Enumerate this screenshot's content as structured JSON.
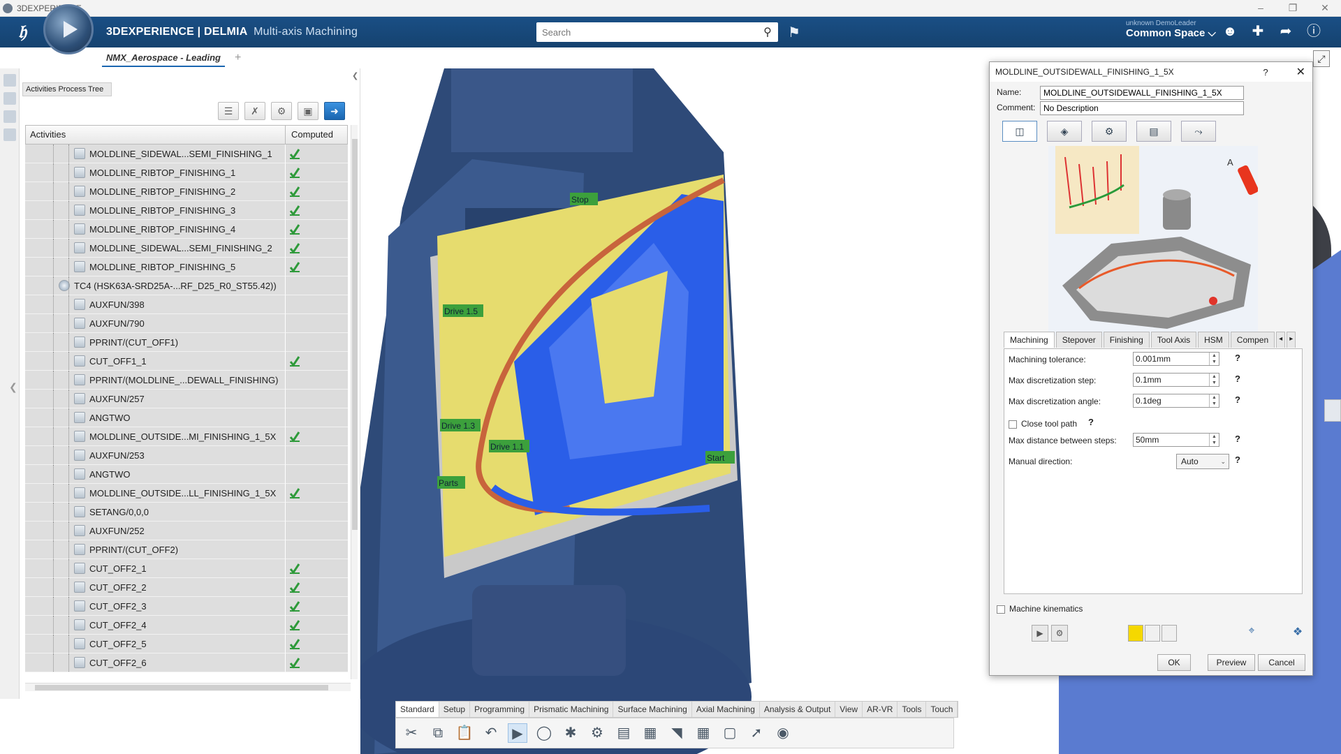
{
  "window": {
    "title": "3DEXPERIENCE"
  },
  "header": {
    "brand_bold": "3DEXPERIENCE | DELMIA",
    "brand_app": "Multi-axis Machining",
    "search_placeholder": "Search",
    "user": "unknown DemoLeader",
    "space": "Common Space ⌵"
  },
  "doc_tab": {
    "label": "NMX_Aerospace - Leading",
    "add": "+"
  },
  "tree": {
    "tab_label": "Activities Process Tree",
    "col_activities": "Activities",
    "col_computed": "Computed",
    "rows": [
      {
        "label": "MOLDLINE_SIDEWAL...SEMI_FINISHING_1",
        "computed": true,
        "indent": 1
      },
      {
        "label": "MOLDLINE_RIBTOP_FINISHING_1",
        "computed": true,
        "indent": 1
      },
      {
        "label": "MOLDLINE_RIBTOP_FINISHING_2",
        "computed": true,
        "indent": 1
      },
      {
        "label": "MOLDLINE_RIBTOP_FINISHING_3",
        "computed": true,
        "indent": 1
      },
      {
        "label": "MOLDLINE_RIBTOP_FINISHING_4",
        "computed": true,
        "indent": 1
      },
      {
        "label": "MOLDLINE_SIDEWAL...SEMI_FINISHING_2",
        "computed": true,
        "indent": 1
      },
      {
        "label": "MOLDLINE_RIBTOP_FINISHING_5",
        "computed": true,
        "indent": 1
      },
      {
        "label": "TC4 (HSK63A-SRD25A-...RF_D25_R0_ST55.42))",
        "computed": false,
        "indent": 0,
        "tool": true
      },
      {
        "label": "AUXFUN/398",
        "computed": false,
        "indent": 1
      },
      {
        "label": "AUXFUN/790",
        "computed": false,
        "indent": 1
      },
      {
        "label": "PPRINT/(CUT_OFF1)",
        "computed": false,
        "indent": 1
      },
      {
        "label": "CUT_OFF1_1",
        "computed": true,
        "indent": 1
      },
      {
        "label": "PPRINT/(MOLDLINE_...DEWALL_FINISHING)",
        "computed": false,
        "indent": 1
      },
      {
        "label": "AUXFUN/257",
        "computed": false,
        "indent": 1
      },
      {
        "label": "ANGTWO",
        "computed": false,
        "indent": 1
      },
      {
        "label": "MOLDLINE_OUTSIDE...MI_FINISHING_1_5X",
        "computed": true,
        "indent": 1
      },
      {
        "label": "AUXFUN/253",
        "computed": false,
        "indent": 1
      },
      {
        "label": "ANGTWO",
        "computed": false,
        "indent": 1
      },
      {
        "label": "MOLDLINE_OUTSIDE...LL_FINISHING_1_5X",
        "computed": true,
        "indent": 1
      },
      {
        "label": "SETANG/0,0,0",
        "computed": false,
        "indent": 1
      },
      {
        "label": "AUXFUN/252",
        "computed": false,
        "indent": 1
      },
      {
        "label": "PPRINT/(CUT_OFF2)",
        "computed": false,
        "indent": 1
      },
      {
        "label": "CUT_OFF2_1",
        "computed": true,
        "indent": 1
      },
      {
        "label": "CUT_OFF2_2",
        "computed": true,
        "indent": 1
      },
      {
        "label": "CUT_OFF2_3",
        "computed": true,
        "indent": 1
      },
      {
        "label": "CUT_OFF2_4",
        "computed": true,
        "indent": 1
      },
      {
        "label": "CUT_OFF2_5",
        "computed": true,
        "indent": 1
      },
      {
        "label": "CUT_OFF2_6",
        "computed": true,
        "indent": 1
      }
    ]
  },
  "viewport_labels": {
    "stop": "Stop",
    "drive15": "Drive 1.5",
    "drive13": "Drive 1.3",
    "drive11": "Drive 1.1",
    "start": "Start",
    "parts": "Parts"
  },
  "bottom_tabs": [
    "Standard",
    "Setup",
    "Programming",
    "Prismatic Machining",
    "Surface Machining",
    "Axial Machining",
    "Analysis & Output",
    "View",
    "AR-VR",
    "Tools",
    "Touch"
  ],
  "dialog": {
    "title": "MOLDLINE_OUTSIDEWALL_FINISHING_1_5X",
    "help": "?",
    "close": "✕",
    "name_label": "Name:",
    "name_value": "MOLDLINE_OUTSIDEWALL_FINISHING_1_5X",
    "comment_label": "Comment:",
    "comment_value": "No Description",
    "illus_letter": "A",
    "tabs": [
      "Machining",
      "Stepover",
      "Finishing",
      "Tool Axis",
      "HSM",
      "Compen"
    ],
    "params": {
      "tol_label": "Machining tolerance:",
      "tol_value": "0.001mm",
      "step_label": "Max discretization step:",
      "step_value": "0.1mm",
      "angle_label": "Max discretization angle:",
      "angle_value": "0.1deg",
      "close_label": "Close tool path",
      "maxdist_label": "Max distance between steps:",
      "maxdist_value": "50mm",
      "manual_label": "Manual direction:",
      "manual_value": "Auto"
    },
    "machine_kinematics": "Machine kinematics",
    "ok": "OK",
    "preview": "Preview",
    "cancel": "Cancel"
  },
  "colors": {
    "header": "#15426f",
    "accent": "#1a66b0",
    "computed_check": "#2e9a3a",
    "part_yellow": "#e6dc6e",
    "part_blue": "#2a5ee8",
    "machine": "#2e4a78"
  }
}
